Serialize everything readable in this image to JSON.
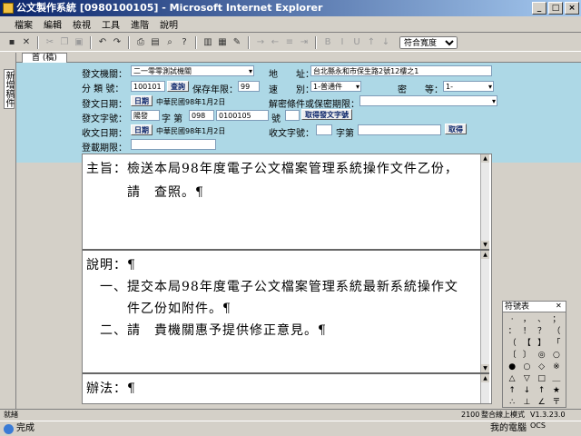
{
  "window": {
    "title": "公文製作系統 [0980100105] - Microsoft Internet Explorer",
    "btn_min": "_",
    "btn_max": "□",
    "btn_close": "×"
  },
  "menu": [
    "檔案",
    "編輯",
    "檢視",
    "工具",
    "進階",
    "說明"
  ],
  "toolbar": {
    "zoom_select": "符合寬度"
  },
  "side_tab": "新增稿件",
  "page_tab": "首 (稿)",
  "form": {
    "sender_label": "發文機關：",
    "sender_value": "二一零零測試機關",
    "address_label": "地　　址：",
    "address_value": "台北縣永和市保生路2號12樓之1",
    "class_label": "分 類 號：",
    "class_value": "100101",
    "class_query_btn": "查詢",
    "retention_label": "保存年限：",
    "retention_value": "99",
    "speed_label": "速　　別：",
    "speed_value": "1-普通件",
    "secret_label": "密　　等：",
    "secret_value": "1-",
    "send_date_label": "發文日期：",
    "send_date_btn": "日期",
    "send_date_value": "中華民國98年1月2日",
    "declass_label": "解密條件或保密期限：",
    "send_no_label": "發文字號：",
    "send_no_prefix": "陽發",
    "send_no_mid_label": "字 第",
    "send_no_a": "098",
    "send_no_b": "0100105",
    "send_no_suffix": "號",
    "send_no_btn": "取得發文字號",
    "recv_date_label": "收文日期：",
    "recv_date_btn": "日期",
    "recv_date_value": "中華民國98年1月2日",
    "recv_no_label": "收文字號：",
    "recv_no_mid": "字第",
    "recv_no_btn": "取得",
    "publish_label": "登載期限："
  },
  "doc": {
    "subject_line1": "主旨：檢送本局98年度電子公文檔案管理系統操作文件乙份，",
    "subject_line2": "　　　請　查照。¶",
    "explain_head": "說明：¶",
    "explain_1a": "　一、提交本局98年度電子公文檔案管理系統最新系統操作文",
    "explain_1b": "　　　件乙份如附件。¶",
    "explain_2": "　二、請　貴機關惠予提供修正意見。¶",
    "method_head": "辦法：¶"
  },
  "palette": {
    "title": "符號表",
    "symbols": [
      "·",
      "，",
      "、",
      "；",
      "：",
      "！",
      "？",
      "（",
      "（",
      "【",
      "】",
      "「",
      "〔",
      "〕",
      "◎",
      "○",
      "●",
      "○",
      "◇",
      "※",
      "△",
      "▽",
      "□",
      "＿",
      "↑",
      "↓",
      "↑",
      "★",
      "∴",
      "⊥",
      "∠",
      "〒"
    ]
  },
  "status": {
    "left": "就緒",
    "code": "2100",
    "mode": "整合線上模式",
    "version": "V1.3.23.0 OCS",
    "done": "完成",
    "zone": "我的電腦"
  }
}
